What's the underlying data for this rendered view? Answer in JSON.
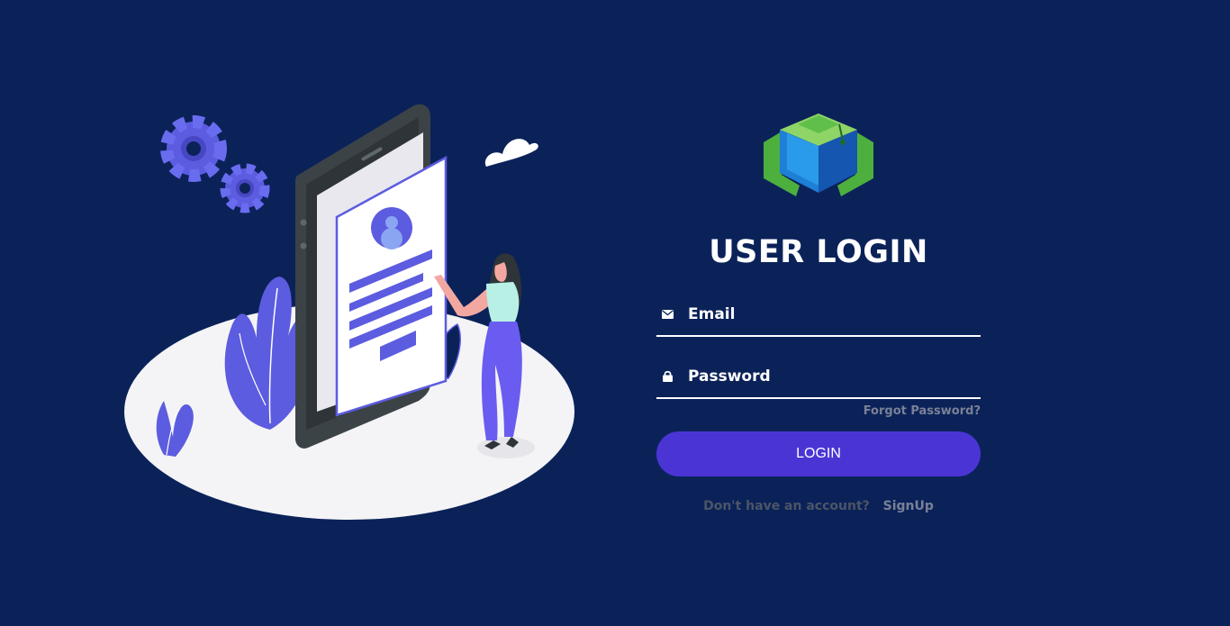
{
  "login": {
    "title": "USER LOGIN",
    "email_placeholder": "Email",
    "password_placeholder": "Password",
    "forgot_label": "Forgot Password?",
    "login_label": "LOGIN",
    "signup_prompt": "Don't have an account?",
    "signup_label": "SignUp"
  },
  "icons": {
    "email": "envelope-icon",
    "password": "lock-icon",
    "logo": "graduation-cube-logo"
  },
  "colors": {
    "background": "#0b2259",
    "accent": "#4a35d4",
    "illustration_purple": "#5c5ce0",
    "muted_text": "#7a8196"
  }
}
